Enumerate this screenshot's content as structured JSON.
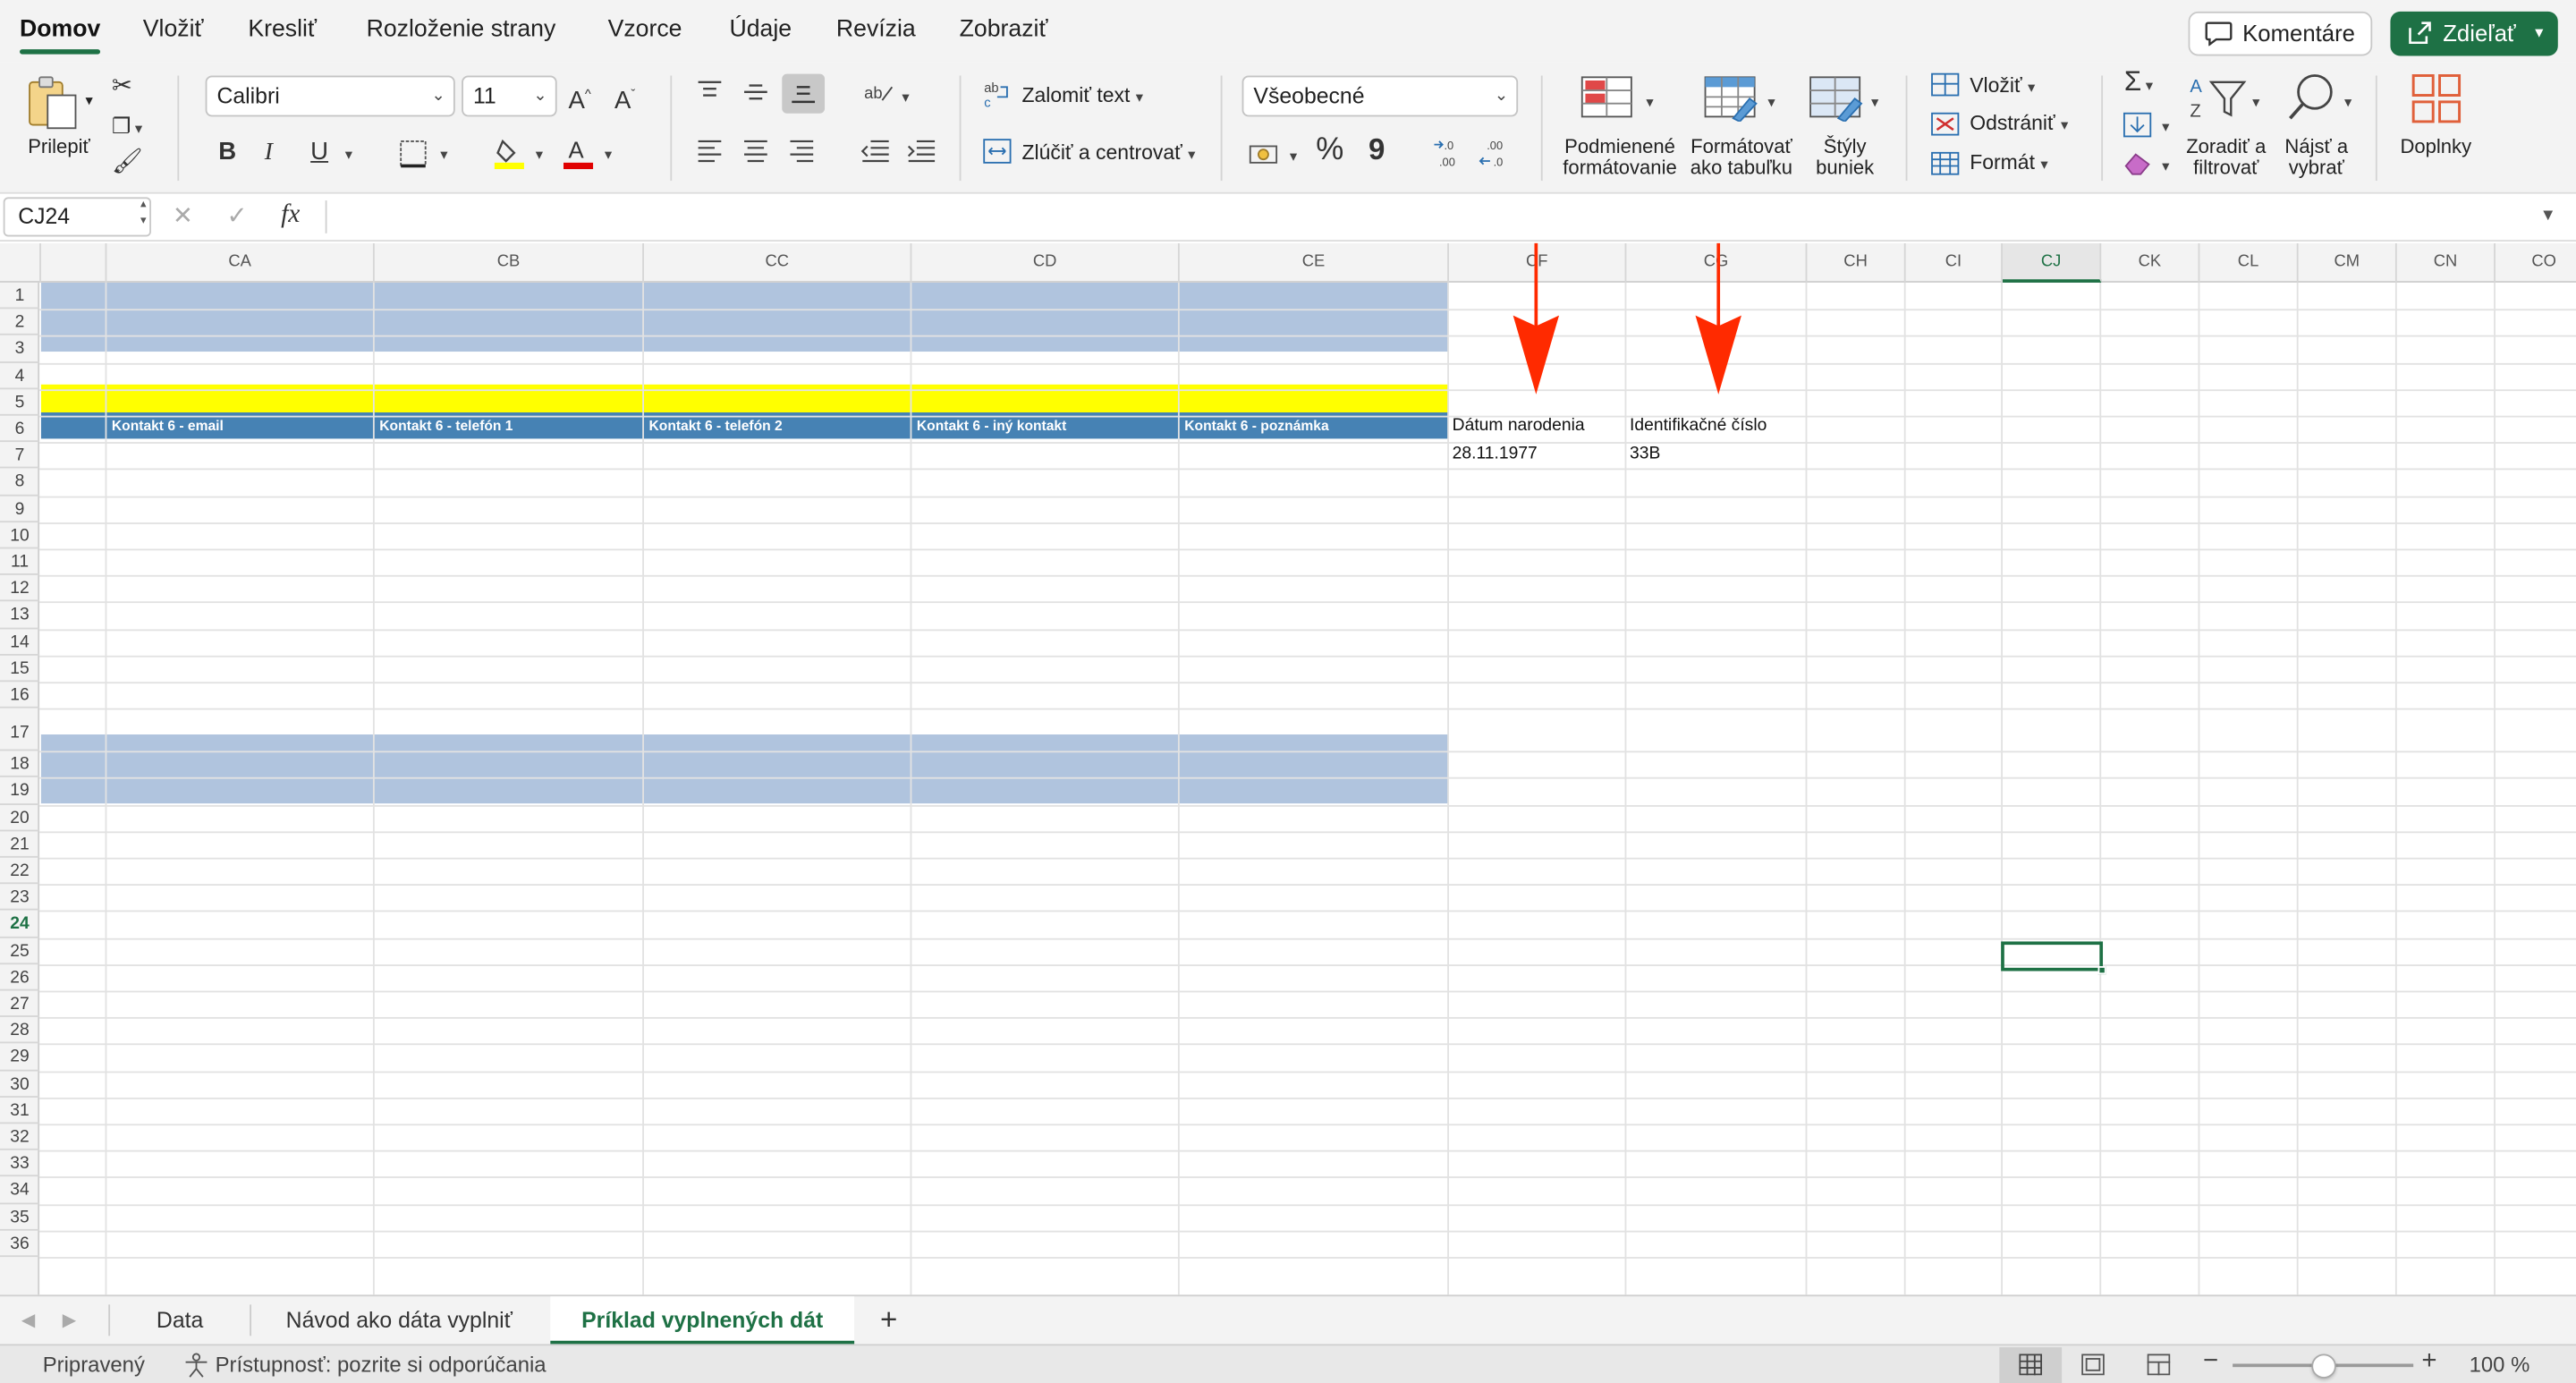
{
  "menu": {
    "tabs": [
      "Domov",
      "Vložiť",
      "Kresliť",
      "Rozloženie strany",
      "Vzorce",
      "Údaje",
      "Revízia",
      "Zobraziť"
    ],
    "active_tab": "Domov",
    "comments_label": "Komentáre",
    "share_label": "Zdieľať"
  },
  "ribbon": {
    "paste_label": "Prilepiť",
    "font_name": "Calibri",
    "font_size": "11",
    "bold": "B",
    "italic": "I",
    "underline": "U",
    "wrap_text": "Zalomiť text",
    "merge_center": "Zlúčiť a centrovať",
    "number_format": "Všeobecné",
    "percent": "%",
    "comma": "9",
    "conditional_formatting": [
      "Podmienené",
      "formátovanie"
    ],
    "format_as_table": [
      "Formátovať",
      "ako tabuľku"
    ],
    "cell_styles": [
      "Štýly",
      "buniek"
    ],
    "insert": "Vložiť",
    "delete": "Odstrániť",
    "format": "Formát",
    "sort_filter": [
      "Zoradiť a",
      "filtrovať"
    ],
    "find_select": [
      "Nájsť a",
      "vybrať"
    ],
    "addins": "Doplnky"
  },
  "formula_bar": {
    "name_box": "CJ24",
    "fx": "fx",
    "formula": ""
  },
  "columns": [
    "CA",
    "CB",
    "CC",
    "CD",
    "CE",
    "CF",
    "CG",
    "CH",
    "CI",
    "CJ",
    "CK",
    "CL",
    "CM",
    "CN",
    "CO"
  ],
  "selected_column": "CJ",
  "rows": [
    "1",
    "2",
    "3",
    "4",
    "5",
    "6",
    "7",
    "8",
    "9",
    "10",
    "11",
    "12",
    "13",
    "14",
    "15",
    "16",
    "17",
    "18",
    "19",
    "20",
    "21",
    "22",
    "23",
    "24",
    "25",
    "26",
    "27",
    "28",
    "29",
    "30",
    "31",
    "32",
    "33",
    "34",
    "35",
    "36"
  ],
  "selected_row": "24",
  "header_row": {
    "CA": "Kontakt 6 - email",
    "CB": "Kontakt 6 - telefón 1",
    "CC": "Kontakt 6 - telefón 2",
    "CD": "Kontakt 6 - iný kontakt",
    "CE": "Kontakt 6 - poznámka",
    "CF": "Dátum narodenia",
    "CG": "Identifikačné číslo"
  },
  "data_row": {
    "CF": "28.11.1977",
    "CG": "33B"
  },
  "colors": {
    "band_blue": "#b0c4de",
    "band_yellow": "#ffff00",
    "header_blue": "#4682b4",
    "accent_green": "#1e7145",
    "arrow_red": "#ff2a00"
  },
  "sheets": {
    "tabs": [
      "Data",
      "Návod ako dáta vyplniť",
      "Príklad vyplnených dát"
    ],
    "active": "Príklad vyplnených dát",
    "add_label": "+"
  },
  "status": {
    "ready": "Pripravený",
    "accessibility": "Prístupnosť: pozrite si odporúčania",
    "zoom": "100 %",
    "zoom_level": 1.0
  }
}
